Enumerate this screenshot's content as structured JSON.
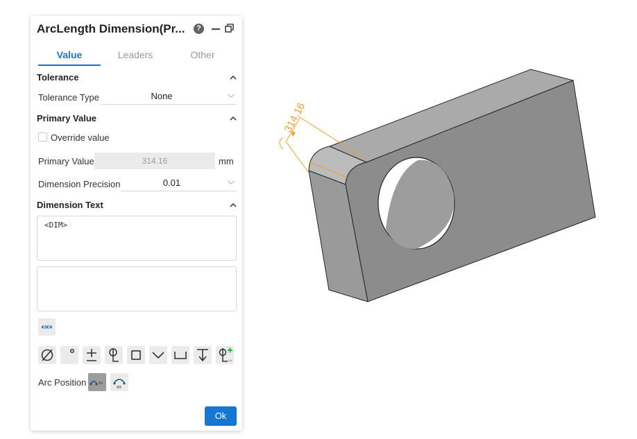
{
  "panel": {
    "title": "ArcLength Dimension(Pr...",
    "help_glyph": "?",
    "tabs": [
      {
        "label": "Value",
        "active": true
      },
      {
        "label": "Leaders",
        "active": false
      },
      {
        "label": "Other",
        "active": false
      }
    ],
    "tolerance": {
      "heading": "Tolerance",
      "type_label": "Tolerance Type",
      "type_value": "None"
    },
    "primary_value": {
      "heading": "Primary Value",
      "override_label": "Override value",
      "override_checked": false,
      "value_label": "Primary Value",
      "value": "314.16",
      "unit": "mm",
      "precision_label": "Dimension Precision",
      "precision_value": "0.01"
    },
    "dimension_text": {
      "heading": "Dimension Text",
      "text1": "<DIM>",
      "text2": ""
    },
    "symbol_buttons": [
      "diameter-icon",
      "degree-icon",
      "plus-minus-icon",
      "centerline-icon",
      "square-icon",
      "countersink-icon",
      "counterbore-icon",
      "depth-icon",
      "add-symbol-icon"
    ],
    "arc_position": {
      "label": "Arc Position",
      "selected": "arc-above"
    },
    "ok_label": "Ok"
  },
  "viewport": {
    "dimension_label": "314.16",
    "colors": {
      "dimension": "#f0a030",
      "accent": "#1677d2"
    }
  }
}
